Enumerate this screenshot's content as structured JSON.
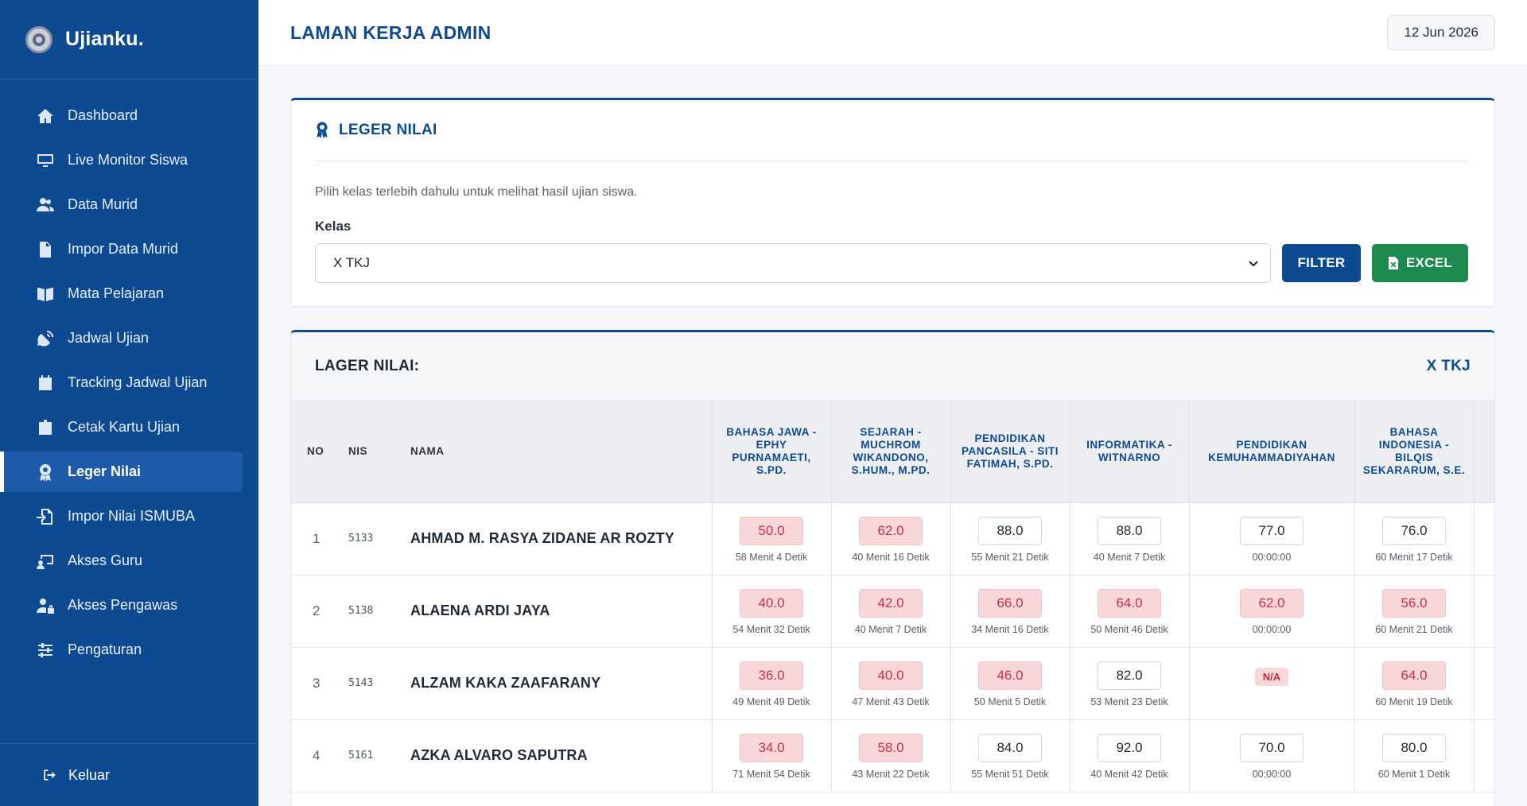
{
  "app": {
    "name": "Ujianku."
  },
  "sidebar": {
    "items": [
      {
        "label": "Dashboard",
        "icon": "home-icon",
        "active": false
      },
      {
        "label": "Live Monitor Siswa",
        "icon": "monitor-icon",
        "active": false
      },
      {
        "label": "Data Murid",
        "icon": "users-icon",
        "active": false
      },
      {
        "label": "Impor Data Murid",
        "icon": "csv-file-icon",
        "active": false
      },
      {
        "label": "Mata Pelajaran",
        "icon": "book-icon",
        "active": false
      },
      {
        "label": "Jadwal Ujian",
        "icon": "satellite-dish-icon",
        "active": false
      },
      {
        "label": "Tracking Jadwal Ujian",
        "icon": "calendar-icon",
        "active": false
      },
      {
        "label": "Cetak Kartu Ujian",
        "icon": "id-badge-icon",
        "active": false
      },
      {
        "label": "Leger Nilai",
        "icon": "award-icon",
        "active": true
      },
      {
        "label": "Impor Nilai ISMUBA",
        "icon": "file-import-icon",
        "active": false
      },
      {
        "label": "Akses Guru",
        "icon": "chalkboard-teacher-icon",
        "active": false
      },
      {
        "label": "Akses Pengawas",
        "icon": "user-lock-icon",
        "active": false
      },
      {
        "label": "Pengaturan",
        "icon": "sliders-icon",
        "active": false
      }
    ],
    "logout_label": "Keluar"
  },
  "header": {
    "title": "LAMAN KERJA ADMIN",
    "date": "12 Jun 2026"
  },
  "filter_card": {
    "title": "LEGER NILAI",
    "helper": "Pilih kelas terlebih dahulu untuk melihat hasil ujian siswa.",
    "kelas_label": "Kelas",
    "kelas_value": "X TKJ",
    "filter_button": "FILTER",
    "excel_button": "EXCEL"
  },
  "table_card": {
    "title": "LAGER NILAI:",
    "kelas": "X TKJ",
    "columns": {
      "no": "NO",
      "nis": "NIS",
      "nama": "NAMA",
      "subjects": [
        "BAHASA JAWA - EPHY PURNAMAETI, S.PD.",
        "SEJARAH - MUCHROM WIKANDONO, S.HUM., M.PD.",
        "PENDIDIKAN PANCASILA - SITI FATIMAH, S.PD.",
        "INFORMATIKA - WITNARNO",
        "PENDIDIKAN KEMUHAMMADIYAHAN",
        "BAHASA INDONESIA - BILQIS SEKARARUM, S.E."
      ]
    },
    "rows": [
      {
        "no": "1",
        "nis": "5133",
        "nama": "AHMAD M. RASYA ZIDANE AR ROZTY",
        "scores": [
          {
            "value": "50.0",
            "low": true,
            "dur": "58 Menit 4 Detik"
          },
          {
            "value": "62.0",
            "low": true,
            "dur": "40 Menit 16 Detik"
          },
          {
            "value": "88.0",
            "low": false,
            "dur": "55 Menit 21 Detik"
          },
          {
            "value": "88.0",
            "low": false,
            "dur": "40 Menit 7 Detik"
          },
          {
            "value": "77.0",
            "low": false,
            "dur": "00:00:00"
          },
          {
            "value": "76.0",
            "low": false,
            "dur": "60 Menit 17 Detik"
          }
        ]
      },
      {
        "no": "2",
        "nis": "5138",
        "nama": "ALAENA ARDI JAYA",
        "scores": [
          {
            "value": "40.0",
            "low": true,
            "dur": "54 Menit 32 Detik"
          },
          {
            "value": "42.0",
            "low": true,
            "dur": "40 Menit 7 Detik"
          },
          {
            "value": "66.0",
            "low": true,
            "dur": "34 Menit 16 Detik"
          },
          {
            "value": "64.0",
            "low": true,
            "dur": "50 Menit 46 Detik"
          },
          {
            "value": "62.0",
            "low": true,
            "dur": "00:00:00"
          },
          {
            "value": "56.0",
            "low": true,
            "dur": "60 Menit 21 Detik"
          }
        ]
      },
      {
        "no": "3",
        "nis": "5143",
        "nama": "ALZAM KAKA ZAAFARANY",
        "scores": [
          {
            "value": "36.0",
            "low": true,
            "dur": "49 Menit 49 Detik"
          },
          {
            "value": "40.0",
            "low": true,
            "dur": "47 Menit 43 Detik"
          },
          {
            "value": "46.0",
            "low": true,
            "dur": "50 Menit 5 Detik"
          },
          {
            "value": "82.0",
            "low": false,
            "dur": "53 Menit 23 Detik"
          },
          {
            "value": "N/A",
            "na": true,
            "dur": ""
          },
          {
            "value": "64.0",
            "low": true,
            "dur": "60 Menit 19 Detik"
          }
        ]
      },
      {
        "no": "4",
        "nis": "5161",
        "nama": "AZKA ALVARO SAPUTRA",
        "scores": [
          {
            "value": "34.0",
            "low": true,
            "dur": "71 Menit 54 Detik"
          },
          {
            "value": "58.0",
            "low": true,
            "dur": "43 Menit 22 Detik"
          },
          {
            "value": "84.0",
            "low": false,
            "dur": "55 Menit 51 Detik"
          },
          {
            "value": "92.0",
            "low": false,
            "dur": "40 Menit 42 Detik"
          },
          {
            "value": "70.0",
            "low": false,
            "dur": "00:00:00"
          },
          {
            "value": "80.0",
            "low": false,
            "dur": "60 Menit 1 Detik"
          }
        ]
      }
    ]
  },
  "colors": {
    "primary": "#0d4a92",
    "success": "#1f8a4f",
    "danger_bg": "#f8d7da",
    "danger_text": "#c8303f"
  }
}
